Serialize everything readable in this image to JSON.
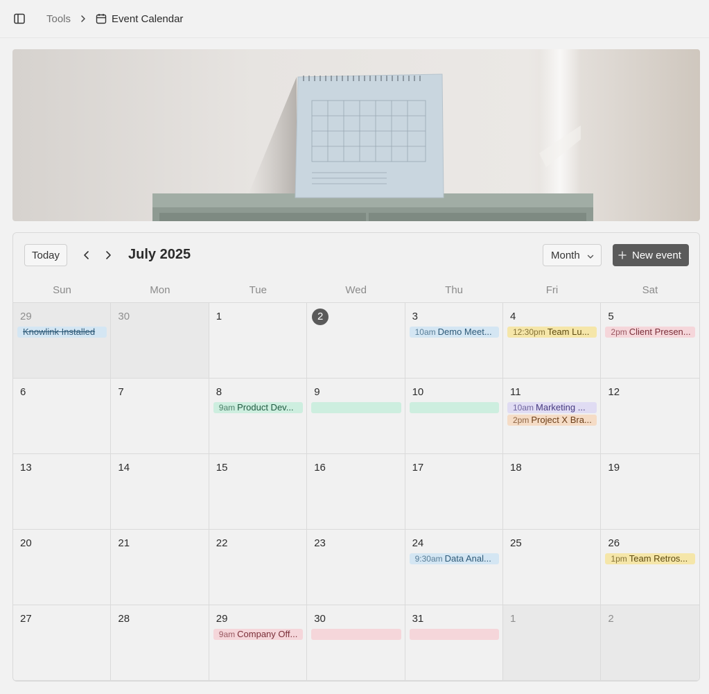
{
  "breadcrumb": {
    "parent": "Tools",
    "current": "Event Calendar"
  },
  "toolbar": {
    "today_label": "Today",
    "month_title": "July 2025",
    "view_label": "Month",
    "new_event_label": "New event"
  },
  "weekdays": [
    "Sun",
    "Mon",
    "Tue",
    "Wed",
    "Thu",
    "Fri",
    "Sat"
  ],
  "colors": {
    "blue_bg": "#d4e6f3",
    "blue_fg": "#2e5a78",
    "yellow_bg": "#f5e6a9",
    "yellow_fg": "#5e4b10",
    "pink_bg": "#f5d6da",
    "pink_fg": "#7a2e38",
    "green_bg": "#cdeedf",
    "green_fg": "#1f5a40",
    "purple_bg": "#e0dcf3",
    "purple_fg": "#463a80",
    "orange_bg": "#f5dcc6",
    "orange_fg": "#6b3d18",
    "today_circle": "#5a5a5a",
    "button_dark": "#5a5a5a"
  },
  "weeks": [
    [
      {
        "day": "29",
        "out": true,
        "events": [
          {
            "time": "",
            "title": "Knowlink Installed",
            "color": "blue",
            "strike": true
          }
        ]
      },
      {
        "day": "30",
        "out": true,
        "events": []
      },
      {
        "day": "1",
        "events": []
      },
      {
        "day": "2",
        "today": true,
        "events": []
      },
      {
        "day": "3",
        "events": [
          {
            "time": "10am",
            "title": "Demo Meet...",
            "color": "blue"
          }
        ]
      },
      {
        "day": "4",
        "events": [
          {
            "time": "12:30pm",
            "title": "Team Lu...",
            "color": "yellow"
          }
        ]
      },
      {
        "day": "5",
        "events": [
          {
            "time": "2pm",
            "title": "Client Presen...",
            "color": "pink"
          }
        ]
      }
    ],
    [
      {
        "day": "6",
        "events": []
      },
      {
        "day": "7",
        "events": []
      },
      {
        "day": "8",
        "events": [
          {
            "time": "9am",
            "title": "Product Dev...",
            "color": "green"
          }
        ]
      },
      {
        "day": "9",
        "events": [
          {
            "time": "",
            "title": "",
            "color": "green"
          }
        ]
      },
      {
        "day": "10",
        "events": [
          {
            "time": "",
            "title": "",
            "color": "green"
          }
        ]
      },
      {
        "day": "11",
        "events": [
          {
            "time": "10am",
            "title": "Marketing ...",
            "color": "purple"
          },
          {
            "time": "2pm",
            "title": "Project X Bra...",
            "color": "orange"
          }
        ]
      },
      {
        "day": "12",
        "events": []
      }
    ],
    [
      {
        "day": "13",
        "events": []
      },
      {
        "day": "14",
        "events": []
      },
      {
        "day": "15",
        "events": []
      },
      {
        "day": "16",
        "events": []
      },
      {
        "day": "17",
        "events": []
      },
      {
        "day": "18",
        "events": []
      },
      {
        "day": "19",
        "events": []
      }
    ],
    [
      {
        "day": "20",
        "events": []
      },
      {
        "day": "21",
        "events": []
      },
      {
        "day": "22",
        "events": []
      },
      {
        "day": "23",
        "events": []
      },
      {
        "day": "24",
        "events": [
          {
            "time": "9:30am",
            "title": "Data Anal...",
            "color": "blue"
          }
        ]
      },
      {
        "day": "25",
        "events": []
      },
      {
        "day": "26",
        "events": [
          {
            "time": "1pm",
            "title": "Team Retros...",
            "color": "yellow"
          }
        ]
      }
    ],
    [
      {
        "day": "27",
        "events": []
      },
      {
        "day": "28",
        "events": []
      },
      {
        "day": "29",
        "events": [
          {
            "time": "9am",
            "title": "Company Off...",
            "color": "pink"
          }
        ]
      },
      {
        "day": "30",
        "events": [
          {
            "time": "",
            "title": "",
            "color": "pink"
          }
        ]
      },
      {
        "day": "31",
        "events": [
          {
            "time": "",
            "title": "",
            "color": "pink"
          }
        ]
      },
      {
        "day": "1",
        "out": true,
        "events": []
      },
      {
        "day": "2",
        "out": true,
        "events": []
      }
    ]
  ]
}
